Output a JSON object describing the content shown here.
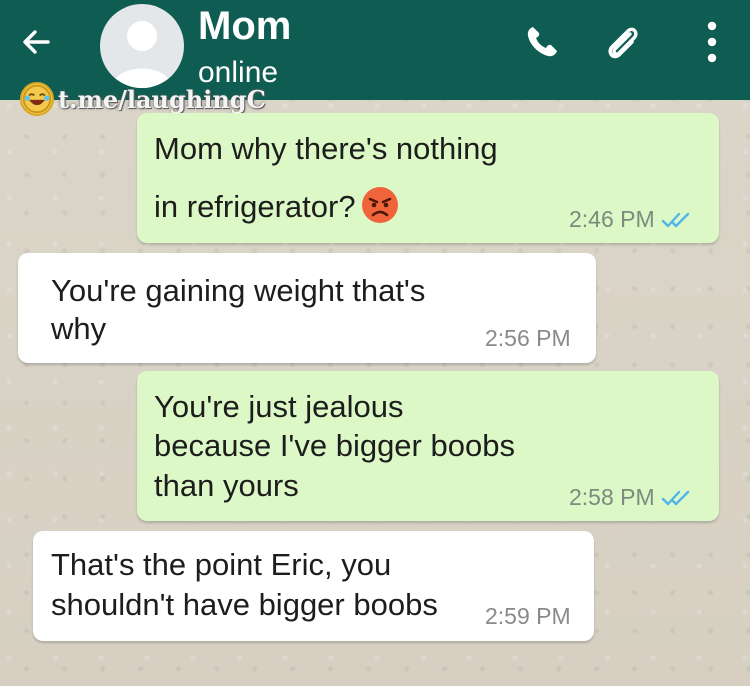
{
  "header": {
    "contact_name": "Mom",
    "status": "online",
    "icons": [
      "back-arrow-icon",
      "avatar-placeholder",
      "phone-icon",
      "paperclip-icon",
      "more-vert-icon"
    ],
    "color": "#0f5d52"
  },
  "watermark": {
    "text": "t.me/laughingC"
  },
  "messages": [
    {
      "direction": "outgoing",
      "lines": [
        "Mom why there's nothing",
        "in refrigerator?"
      ],
      "emoji": "angry-face",
      "time": "2:46 PM",
      "status": "read"
    },
    {
      "direction": "incoming",
      "lines": [
        "You're gaining weight that's",
        "why"
      ],
      "time": "2:56 PM"
    },
    {
      "direction": "outgoing",
      "lines": [
        "You're just jealous",
        "because I've bigger boobs",
        "than yours"
      ],
      "time": "2:58 PM",
      "status": "read"
    },
    {
      "direction": "incoming",
      "lines": [
        "That's the point Eric, you",
        "shouldn't have bigger boobs"
      ],
      "time": "2:59 PM"
    }
  ],
  "colors": {
    "outgoing_bubble": "#dcf8c6",
    "incoming_bubble": "#ffffff",
    "read_ticks": "#4fb6ec"
  }
}
